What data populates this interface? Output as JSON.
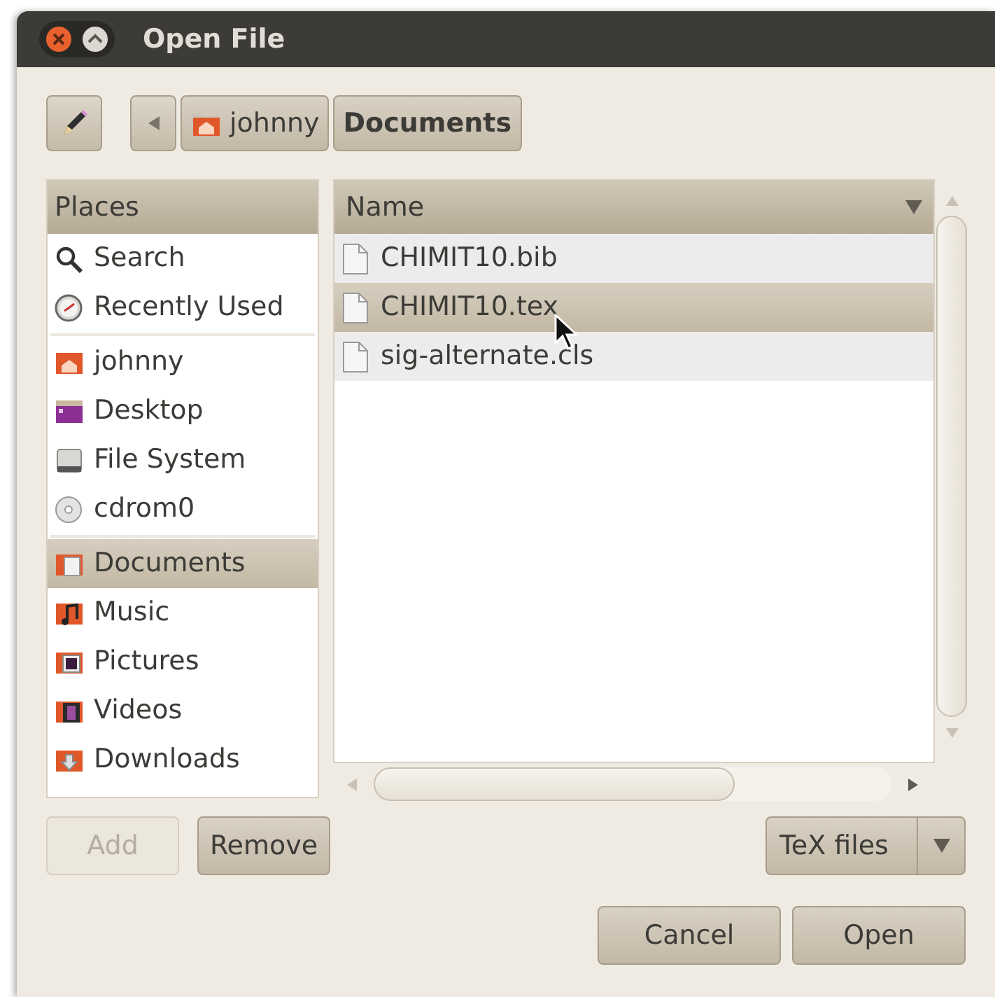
{
  "window": {
    "title": "Open File"
  },
  "path_bar": {
    "crumbs": [
      {
        "label": "johnny",
        "selected": false
      },
      {
        "label": "Documents",
        "selected": true
      }
    ]
  },
  "places": {
    "header": "Places",
    "groups": [
      [
        {
          "label": "Search",
          "selected": false
        },
        {
          "label": "Recently Used",
          "selected": false
        }
      ],
      [
        {
          "label": "johnny",
          "selected": false
        },
        {
          "label": "Desktop",
          "selected": false
        },
        {
          "label": "File System",
          "selected": false
        },
        {
          "label": "cdrom0",
          "selected": false
        }
      ],
      [
        {
          "label": "Documents",
          "selected": true
        },
        {
          "label": "Music",
          "selected": false
        },
        {
          "label": "Pictures",
          "selected": false
        },
        {
          "label": "Videos",
          "selected": false
        },
        {
          "label": "Downloads",
          "selected": false
        }
      ]
    ]
  },
  "files": {
    "column": "Name",
    "rows": [
      {
        "name": "CHIMIT10.bib",
        "selected": false
      },
      {
        "name": "CHIMIT10.tex",
        "selected": true
      },
      {
        "name": "sig-alternate.cls",
        "selected": false
      }
    ]
  },
  "places_buttons": [
    {
      "label": "Add",
      "disabled": true
    },
    {
      "label": "Remove",
      "disabled": false
    }
  ],
  "filter": {
    "value": "TeX files"
  },
  "buttons": [
    {
      "label": "Cancel"
    },
    {
      "label": "Open"
    }
  ]
}
